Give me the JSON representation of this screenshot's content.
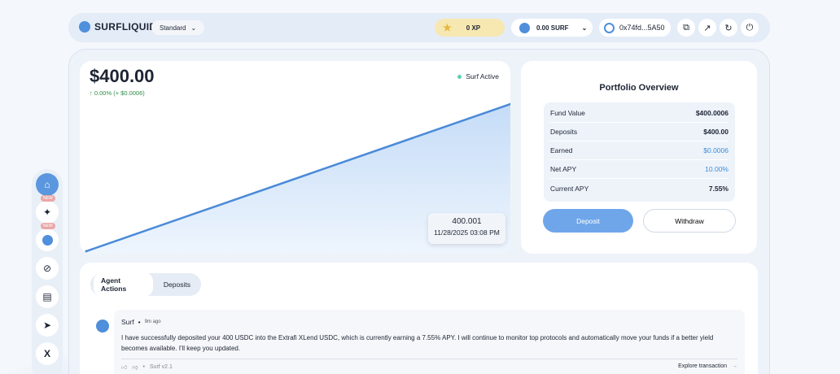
{
  "header": {
    "brand": "SURFLIQUID",
    "plan": "Standard",
    "xp": "0 XP",
    "balance": "0.00 SURF",
    "wallet": "0x74fd...5A50"
  },
  "chart": {
    "value": "$400.00",
    "change": "0.00% (+ $0.0006)",
    "status": "Surf Active",
    "tooltip_value": "400.001",
    "tooltip_time": "11/28/2025 03:08 PM"
  },
  "chart_data": {
    "type": "area",
    "series": [
      {
        "values": [
          400.0,
          400.001
        ]
      }
    ]
  },
  "portfolio": {
    "title": "Portfolio Overview",
    "rows": [
      {
        "label": "Fund Value",
        "value": "$400.0006"
      },
      {
        "label": "Deposits",
        "value": "$400.00"
      },
      {
        "label": "Earned",
        "value": "$0.0006"
      },
      {
        "label": "Net APY",
        "value": "10.00%"
      },
      {
        "label": "Current APY",
        "value": "7.55%"
      }
    ],
    "deposit_label": "Deposit",
    "withdraw_label": "Withdraw"
  },
  "actions": {
    "tabs": [
      "Agent Actions",
      "Deposits"
    ],
    "message": {
      "author": "Surf",
      "time": "9m ago",
      "text": "I have successfully deposited your 400 USDC into the Extrafi XLend USDC, which is currently earning a 7.55% APY. I will continue to monitor top protocols and automatically move your funds if a better yield becomes available. I'll keep you updated.",
      "version": "Surf v2.1",
      "link": "Explore transaction"
    }
  },
  "sidebar": {
    "badges": [
      "NEW",
      "NEW"
    ]
  },
  "colors": {
    "accent": "#5b97df",
    "positive": "#2f8d46",
    "xp_pill": "#f7e8b2"
  }
}
